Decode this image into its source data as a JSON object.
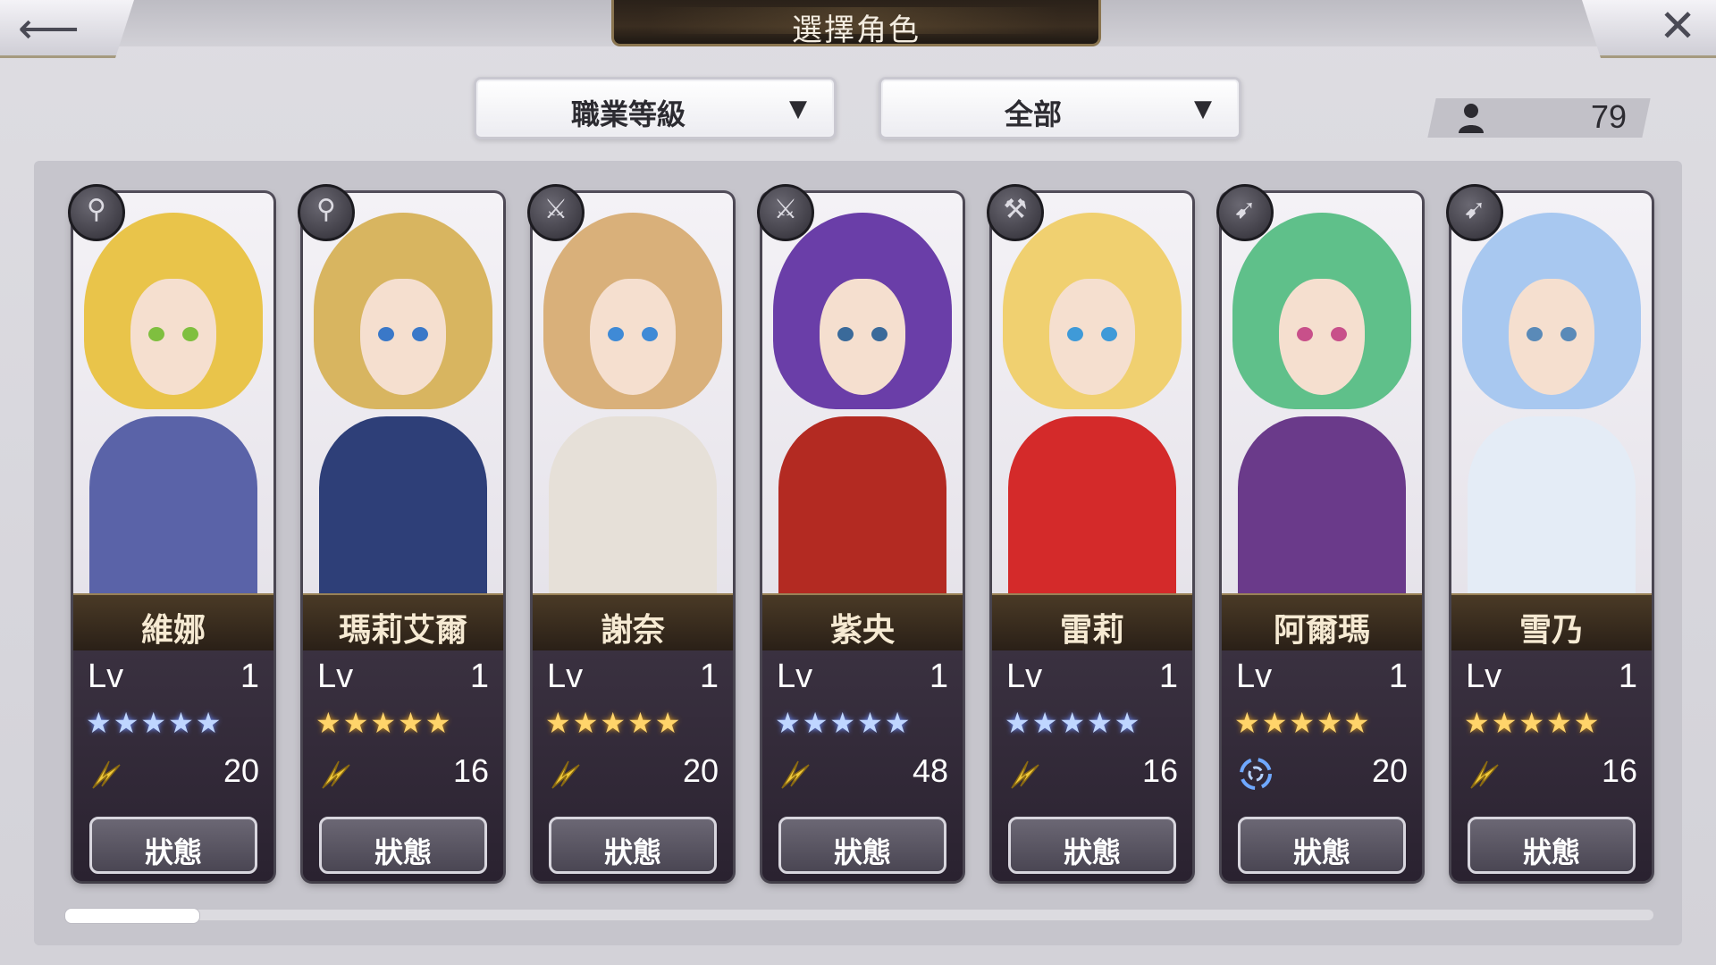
{
  "header": {
    "title": "選擇角色",
    "back_icon": "back-arrow-icon",
    "close_icon": "close-icon"
  },
  "filters": {
    "sort": {
      "label": "職業等級"
    },
    "category": {
      "label": "全部"
    }
  },
  "character_count": "79",
  "colors": {
    "title_plate": "#2a2119",
    "panel": "#c6c5cc",
    "card_info": "#3a3140",
    "star_blue": "#bfd6ff",
    "star_gold": "#ffd46a"
  },
  "characters": [
    {
      "name": "維娜",
      "lv_label": "Lv",
      "level": "1",
      "stars": "★★★★★",
      "star_color": "blue",
      "element": "wind",
      "element_value": "20",
      "status_label": "狀態",
      "class_icon": "staff-icon",
      "hair": "#e9c44a",
      "eye": "#7fbf3f",
      "outfit": "#5a63a8"
    },
    {
      "name": "瑪莉艾爾",
      "lv_label": "Lv",
      "level": "1",
      "stars": "★★★★★",
      "star_color": "gold",
      "element": "wind",
      "element_value": "16",
      "status_label": "狀態",
      "class_icon": "staff-icon",
      "hair": "#d8b560",
      "eye": "#3a78c8",
      "outfit": "#2e3f78"
    },
    {
      "name": "謝奈",
      "lv_label": "Lv",
      "level": "1",
      "stars": "★★★★★",
      "star_color": "gold",
      "element": "wind",
      "element_value": "20",
      "status_label": "狀態",
      "class_icon": "sword-icon",
      "hair": "#d9b07a",
      "eye": "#3f8ad6",
      "outfit": "#e6e0d8"
    },
    {
      "name": "紫央",
      "lv_label": "Lv",
      "level": "1",
      "stars": "★★★★★",
      "star_color": "blue",
      "element": "wind",
      "element_value": "48",
      "status_label": "狀態",
      "class_icon": "sword-icon",
      "hair": "#6a3ea8",
      "eye": "#3a6a9a",
      "outfit": "#b32a22"
    },
    {
      "name": "雷莉",
      "lv_label": "Lv",
      "level": "1",
      "stars": "★★★★★",
      "star_color": "blue",
      "element": "wind",
      "element_value": "16",
      "status_label": "狀態",
      "class_icon": "axe-icon",
      "hair": "#f0d070",
      "eye": "#3f9ad8",
      "outfit": "#d42a2a"
    },
    {
      "name": "阿爾瑪",
      "lv_label": "Lv",
      "level": "1",
      "stars": "★★★★★",
      "star_color": "gold",
      "element": "vortex",
      "element_value": "20",
      "status_label": "狀態",
      "class_icon": "bow-icon",
      "hair": "#5fc08a",
      "eye": "#c8508a",
      "outfit": "#6a3a8a"
    },
    {
      "name": "雪乃",
      "lv_label": "Lv",
      "level": "1",
      "stars": "★★★★★",
      "star_color": "gold",
      "element": "wind",
      "element_value": "16",
      "status_label": "狀態",
      "class_icon": "bow-icon",
      "hair": "#a8c8f0",
      "eye": "#5a8ab8",
      "outfit": "#e4ecf6"
    }
  ]
}
